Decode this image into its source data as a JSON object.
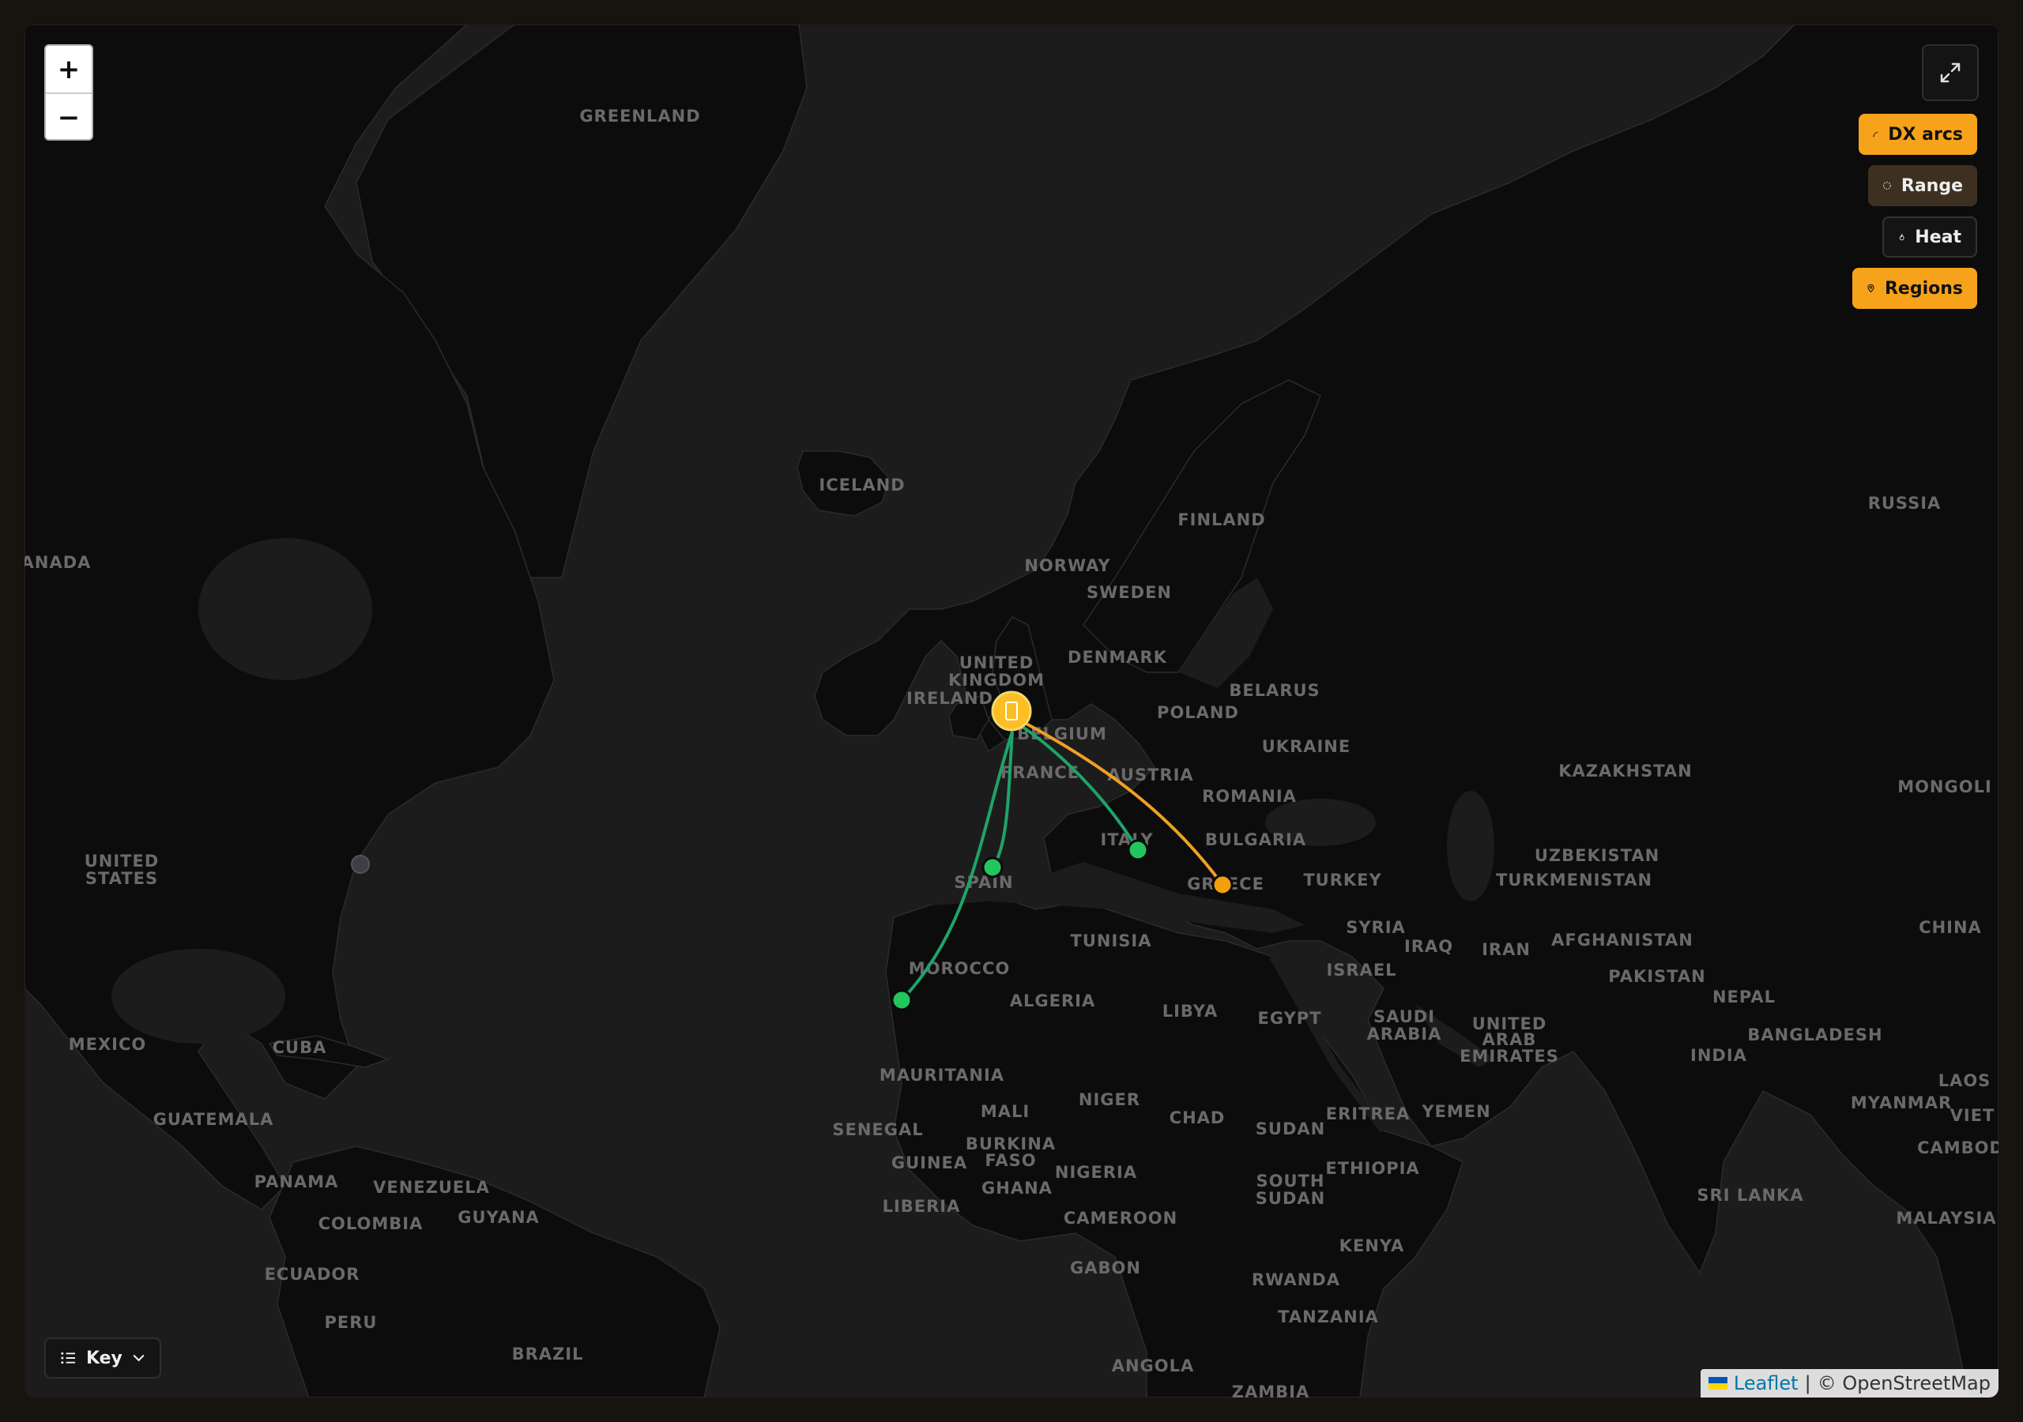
{
  "map": {
    "labels": [
      {
        "id": "greenland",
        "text": "GREENLAND"
      },
      {
        "id": "iceland",
        "text": "ICELAND"
      },
      {
        "id": "canada",
        "text": "ANADA"
      },
      {
        "id": "us1",
        "text": "UNITED"
      },
      {
        "id": "us2",
        "text": "STATES"
      },
      {
        "id": "mexico",
        "text": "MEXICO"
      },
      {
        "id": "cuba",
        "text": "CUBA"
      },
      {
        "id": "guatemala",
        "text": "GUATEMALA"
      },
      {
        "id": "panama",
        "text": "PANAMA"
      },
      {
        "id": "venezuela",
        "text": "VENEZUELA"
      },
      {
        "id": "guyana",
        "text": "GUYANA"
      },
      {
        "id": "colombia",
        "text": "COLOMBIA"
      },
      {
        "id": "ecuador",
        "text": "ECUADOR"
      },
      {
        "id": "peru",
        "text": "PERU"
      },
      {
        "id": "brazil",
        "text": "BRAZIL"
      },
      {
        "id": "uk1",
        "text": "UNITED"
      },
      {
        "id": "uk2",
        "text": "KINGDOM"
      },
      {
        "id": "ireland",
        "text": "IRELAND"
      },
      {
        "id": "belgium",
        "text": "BELGIUM"
      },
      {
        "id": "france",
        "text": "FRANCE"
      },
      {
        "id": "spain",
        "text": "SPAIN"
      },
      {
        "id": "norway",
        "text": "NORWAY"
      },
      {
        "id": "sweden",
        "text": "SWEDEN"
      },
      {
        "id": "finland",
        "text": "FINLAND"
      },
      {
        "id": "denmark",
        "text": "DENMARK"
      },
      {
        "id": "poland",
        "text": "POLAND"
      },
      {
        "id": "belarus",
        "text": "BELARUS"
      },
      {
        "id": "ukraine",
        "text": "UKRAINE"
      },
      {
        "id": "austria",
        "text": "AUSTRIA"
      },
      {
        "id": "romania",
        "text": "ROMANIA"
      },
      {
        "id": "bulgaria",
        "text": "BULGARIA"
      },
      {
        "id": "italy",
        "text": "ITALY"
      },
      {
        "id": "greece",
        "text": "GREECE"
      },
      {
        "id": "turkey",
        "text": "TURKEY"
      },
      {
        "id": "russia",
        "text": "RUSSIA"
      },
      {
        "id": "kazakhstan",
        "text": "KAZAKHSTAN"
      },
      {
        "id": "mongolia",
        "text": "MONGOLI"
      },
      {
        "id": "uzbekistan",
        "text": "UZBEKISTAN"
      },
      {
        "id": "turkmenistan",
        "text": "TURKMENISTAN"
      },
      {
        "id": "china",
        "text": "CHINA"
      },
      {
        "id": "afghanistan",
        "text": "AFGHANISTAN"
      },
      {
        "id": "iran",
        "text": "IRAN"
      },
      {
        "id": "iraq",
        "text": "IRAQ"
      },
      {
        "id": "syria",
        "text": "SYRIA"
      },
      {
        "id": "israel",
        "text": "ISRAEL"
      },
      {
        "id": "pakistan",
        "text": "PAKISTAN"
      },
      {
        "id": "nepal",
        "text": "NEPAL"
      },
      {
        "id": "india",
        "text": "INDIA"
      },
      {
        "id": "bangladesh",
        "text": "BANGLADESH"
      },
      {
        "id": "myanmar",
        "text": "MYANMAR"
      },
      {
        "id": "laos",
        "text": "LAOS"
      },
      {
        "id": "viet",
        "text": "VIET"
      },
      {
        "id": "cambod",
        "text": "CAMBOD"
      },
      {
        "id": "malaysia",
        "text": "MALAYSIA"
      },
      {
        "id": "srilanka",
        "text": "SRI LANKA"
      },
      {
        "id": "saudi1",
        "text": "SAUDI"
      },
      {
        "id": "saudi2",
        "text": "ARABIA"
      },
      {
        "id": "uae1",
        "text": "UNITED"
      },
      {
        "id": "uae2",
        "text": "ARAB"
      },
      {
        "id": "uae3",
        "text": "EMIRATES"
      },
      {
        "id": "yemen",
        "text": "YEMEN"
      },
      {
        "id": "egypt",
        "text": "EGYPT"
      },
      {
        "id": "libya",
        "text": "LIBYA"
      },
      {
        "id": "tunisia",
        "text": "TUNISIA"
      },
      {
        "id": "algeria",
        "text": "ALGERIA"
      },
      {
        "id": "morocco",
        "text": "MOROCCO"
      },
      {
        "id": "mauritania",
        "text": "MAURITANIA"
      },
      {
        "id": "mali",
        "text": "MALI"
      },
      {
        "id": "niger",
        "text": "NIGER"
      },
      {
        "id": "chad",
        "text": "CHAD"
      },
      {
        "id": "sudan",
        "text": "SUDAN"
      },
      {
        "id": "eritrea",
        "text": "ERITREA"
      },
      {
        "id": "ethiopia",
        "text": "ETHIOPIA"
      },
      {
        "id": "ssudan1",
        "text": "SOUTH"
      },
      {
        "id": "ssudan2",
        "text": "SUDAN"
      },
      {
        "id": "senegal",
        "text": "SENEGAL"
      },
      {
        "id": "guinea",
        "text": "GUINEA"
      },
      {
        "id": "burkina1",
        "text": "BURKINA"
      },
      {
        "id": "burkina2",
        "text": "FASO"
      },
      {
        "id": "ghana",
        "text": "GHANA"
      },
      {
        "id": "liberia",
        "text": "LIBERIA"
      },
      {
        "id": "nigeria",
        "text": "NIGERIA"
      },
      {
        "id": "cameroon",
        "text": "CAMEROON"
      },
      {
        "id": "gabon",
        "text": "GABON"
      },
      {
        "id": "kenya",
        "text": "KENYA"
      },
      {
        "id": "rwanda",
        "text": "RWANDA"
      },
      {
        "id": "tanzania",
        "text": "TANZANIA"
      },
      {
        "id": "angola",
        "text": "ANGOLA"
      },
      {
        "id": "zambia",
        "text": "ZAMBIA"
      }
    ],
    "home_station_icon": "radio-tower-icon",
    "colors": {
      "arc_green": "#1fa36a",
      "arc_orange": "#f0a023",
      "point_green": "#22c55e",
      "point_orange": "#f59e0b",
      "home": "#fbbf24",
      "land": "#0c0c0c",
      "sea": "#1c1c1c"
    },
    "contacts": [
      {
        "id": "contact-spain",
        "color": "green"
      },
      {
        "id": "contact-canary",
        "color": "green"
      },
      {
        "id": "contact-italy",
        "color": "green"
      },
      {
        "id": "contact-greece",
        "color": "orange"
      },
      {
        "id": "contact-us-east",
        "color": "grey"
      }
    ]
  },
  "controls": {
    "zoom_in": "+",
    "zoom_out": "−",
    "fullscreen_icon": "expand-icon",
    "layers": [
      {
        "id": "dx-arcs",
        "label": "DX arcs",
        "icon": "arc-icon",
        "state": "on"
      },
      {
        "id": "range",
        "label": "Range",
        "icon": "dashed-circle-icon",
        "state": "dim"
      },
      {
        "id": "heat",
        "label": "Heat",
        "icon": "flame-icon",
        "state": "off"
      },
      {
        "id": "regions",
        "label": "Regions",
        "icon": "map-pin-icon",
        "state": "on"
      }
    ],
    "key_label": "Key"
  },
  "attribution": {
    "leaflet": "Leaflet",
    "separator": "|",
    "osm": "© OpenStreetMap"
  }
}
